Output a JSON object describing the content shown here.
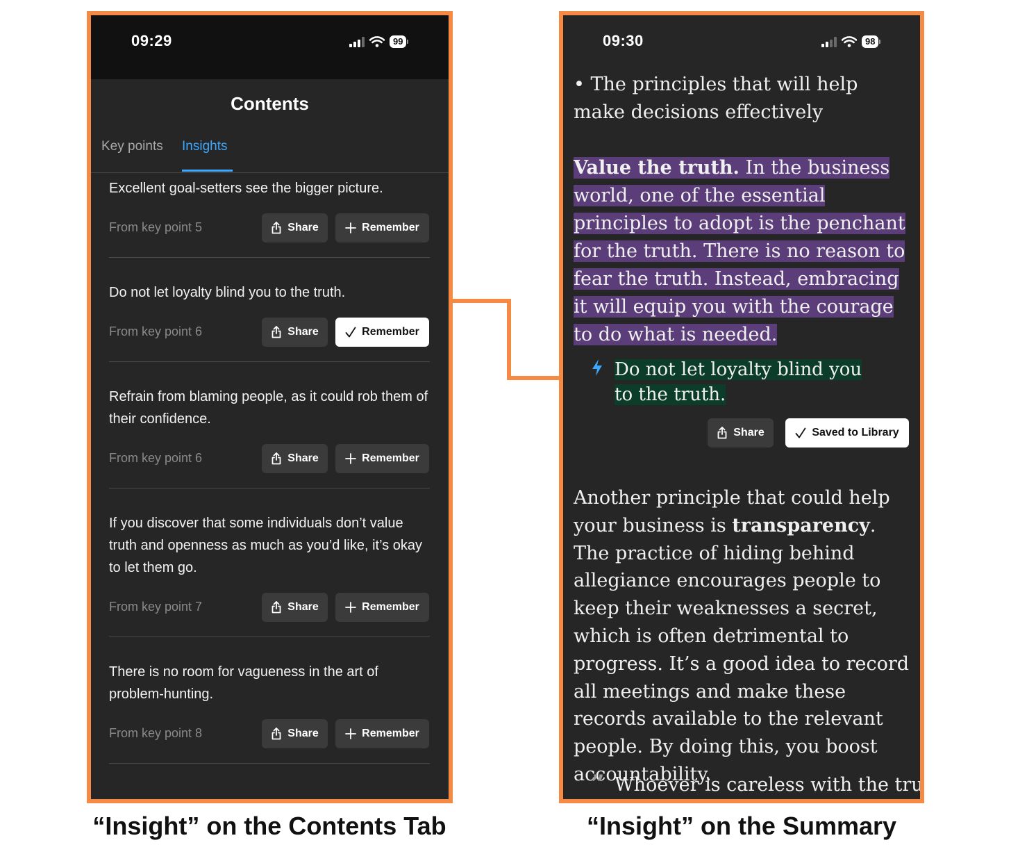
{
  "left_phone": {
    "status": {
      "time": "09:29",
      "battery": "99"
    },
    "title": "Contents",
    "tabs": [
      {
        "label": "Key points",
        "active": false
      },
      {
        "label": "Insights",
        "active": true
      }
    ],
    "share_label": "Share",
    "remember_label": "Remember",
    "insights": [
      {
        "text": "Excellent goal-setters see the bigger picture.",
        "from": "From key point 5",
        "remembered": false
      },
      {
        "text": "Do not let loyalty blind you to the truth.",
        "from": "From key point 6",
        "remembered": true
      },
      {
        "text": "Refrain from blaming people, as it could rob them of their confidence.",
        "from": "From key point 6",
        "remembered": false
      },
      {
        "text": "If you discover that some individuals don’t value truth and openness as much as you’d like, it’s okay to let them go.",
        "from": "From key point 7",
        "remembered": false
      },
      {
        "text": "There is no room for vagueness in the art of problem-hunting.",
        "from": "From key point 8",
        "remembered": false
      }
    ]
  },
  "right_phone": {
    "status": {
      "time": "09:30",
      "battery": "98"
    },
    "bullet": "• The principles that will help make decisions effectively",
    "highlight_bold": "Value the truth.",
    "highlight_rest": " In the business world, one of the essential principles to adopt is the penchant for the truth. There is no reason to fear the truth. Instead, embracing it will equip you with the courage to do what is needed.",
    "insight_text": "Do not let loyalty blind you to the truth.",
    "share_label": "Share",
    "saved_label": "Saved to Library",
    "para2_a": "Another principle that could help your business is ",
    "para2_bold": "transparency",
    "para2_b": ". The practice of hiding behind allegiance encourages people to keep their weaknesses a secret, which is often detrimental to progress. It’s a good idea to record all meetings and make these records available to the relevant people. By doing this, you boost accountability.",
    "quote_text": "Whoever is careless with the truth"
  },
  "captions": {
    "left": "“Insight” on the Contents Tab",
    "right": "“Insight” on the Summary"
  },
  "colors": {
    "frame": "#f58a45",
    "accent_blue": "#3da8ff",
    "highlight_purple": "#5a3d79",
    "highlight_green": "#0c3d2a"
  }
}
